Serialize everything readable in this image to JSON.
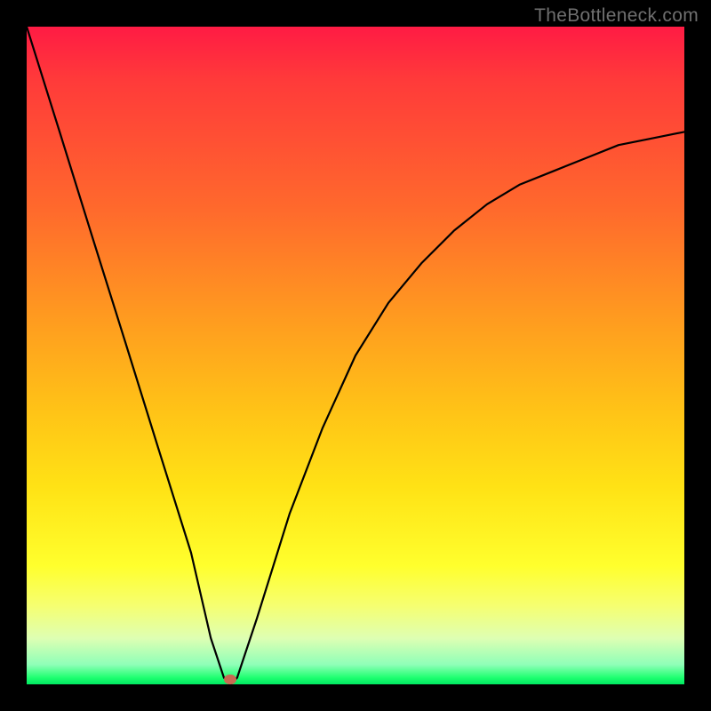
{
  "watermark": "TheBottleneck.com",
  "chart_data": {
    "type": "line",
    "title": "",
    "xlabel": "",
    "ylabel": "",
    "xlim": [
      0,
      100
    ],
    "ylim": [
      0,
      100
    ],
    "grid": false,
    "legend": false,
    "background_gradient": {
      "type": "vertical",
      "stops": [
        {
          "pos": 0,
          "color": "#ff1b44"
        },
        {
          "pos": 28,
          "color": "#ff6a2c"
        },
        {
          "pos": 58,
          "color": "#ffc217"
        },
        {
          "pos": 82,
          "color": "#ffff2d"
        },
        {
          "pos": 97,
          "color": "#8fffb8"
        },
        {
          "pos": 100,
          "color": "#00e861"
        }
      ]
    },
    "series": [
      {
        "name": "bottleneck-curve",
        "color": "#000000",
        "x": [
          0,
          5,
          10,
          15,
          20,
          25,
          28,
          30,
          31,
          32,
          35,
          40,
          45,
          50,
          55,
          60,
          65,
          70,
          75,
          80,
          85,
          90,
          95,
          100
        ],
        "y": [
          100,
          84,
          68,
          52,
          36,
          20,
          7,
          1,
          0,
          1,
          10,
          26,
          39,
          50,
          58,
          64,
          69,
          73,
          76,
          78,
          80,
          82,
          83,
          84
        ]
      }
    ],
    "marker": {
      "name": "minimum-point",
      "x": 31,
      "y": 0,
      "color": "#c96a52"
    }
  },
  "colors": {
    "frame": "#000000",
    "curve": "#000000",
    "marker": "#c96a52",
    "watermark": "#6f6f6f"
  }
}
